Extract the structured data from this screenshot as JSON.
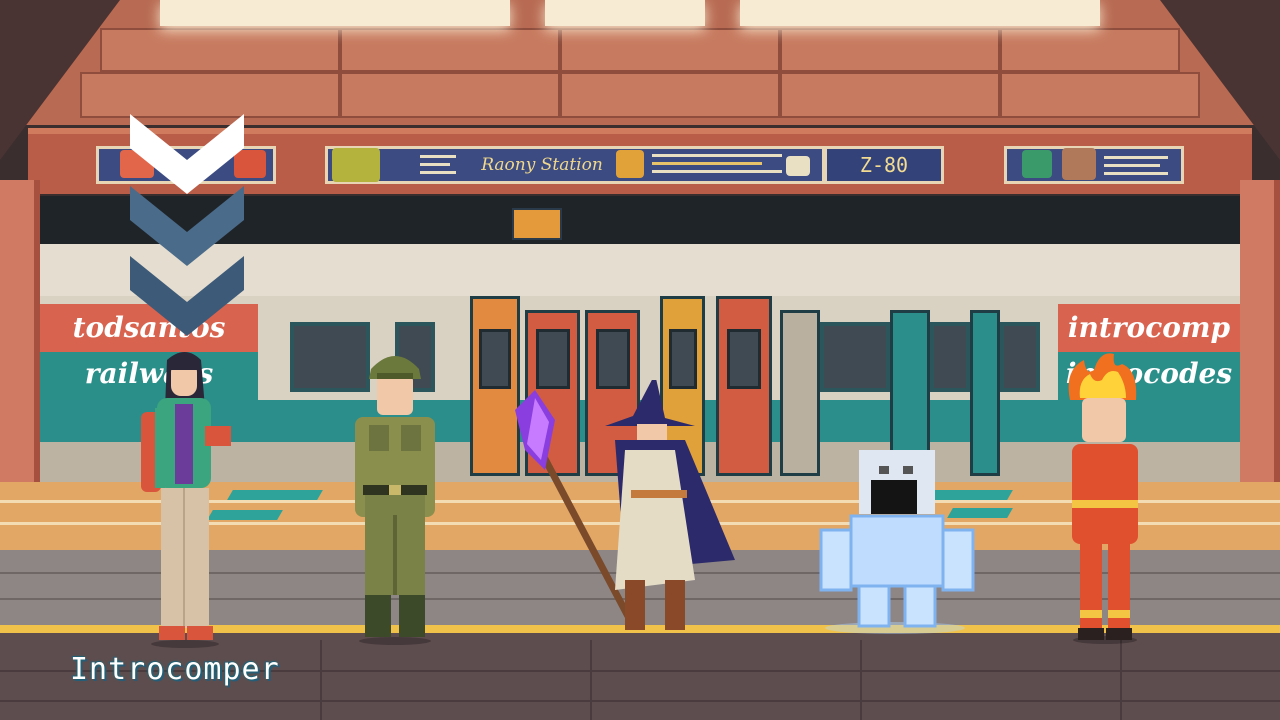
{
  "station": {
    "name": "Raony Station",
    "platform_code": "Z-80"
  },
  "ads": {
    "left": {
      "line1": "todsantos",
      "line2": "railways"
    },
    "right": {
      "line1": "introcomp",
      "line2": "introcodes"
    }
  },
  "player": {
    "name": "Introcomper"
  },
  "indicator": {
    "type": "down-chevrons",
    "count": 3,
    "colors": [
      "#ffffff",
      "#4a6b8a",
      "#3d5a78"
    ]
  },
  "characters": [
    {
      "id": "student",
      "label": "student-npc"
    },
    {
      "id": "soldier",
      "label": "soldier-npc"
    },
    {
      "id": "wizard",
      "label": "wizard-npc"
    },
    {
      "id": "ice-golem",
      "label": "ice-golem-npc"
    },
    {
      "id": "fire-kid",
      "label": "fire-kid-npc"
    }
  ]
}
